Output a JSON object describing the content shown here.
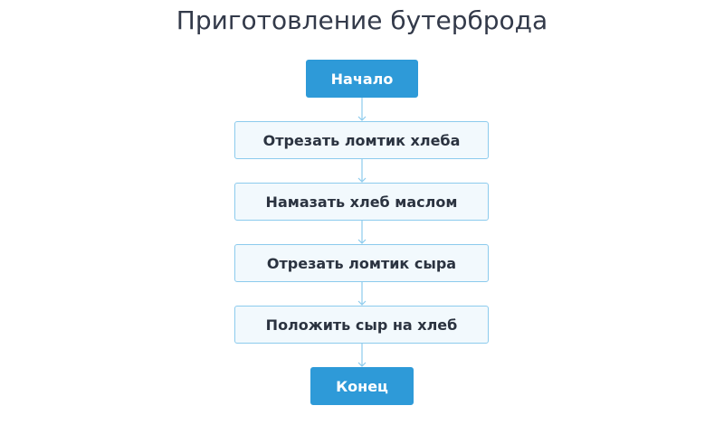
{
  "diagram": {
    "title": "Приготовление бутерброда",
    "accent_color": "#2e9ad8",
    "process_fill": "#f2f9fd",
    "process_border": "#8ccbed",
    "connector_color": "#8ccbed",
    "nodes": [
      {
        "id": "start",
        "type": "terminal",
        "label": "Начало"
      },
      {
        "id": "step1",
        "type": "process",
        "label": "Отрезать ломтик хлеба"
      },
      {
        "id": "step2",
        "type": "process",
        "label": "Намазать хлеб маслом"
      },
      {
        "id": "step3",
        "type": "process",
        "label": "Отрезать ломтик сыра"
      },
      {
        "id": "step4",
        "type": "process",
        "label": "Положить сыр на хлеб"
      },
      {
        "id": "end",
        "type": "terminal",
        "label": "Конец"
      }
    ],
    "edges": [
      {
        "from": "start",
        "to": "step1"
      },
      {
        "from": "step1",
        "to": "step2"
      },
      {
        "from": "step2",
        "to": "step3"
      },
      {
        "from": "step3",
        "to": "step4"
      },
      {
        "from": "step4",
        "to": "end"
      }
    ]
  }
}
